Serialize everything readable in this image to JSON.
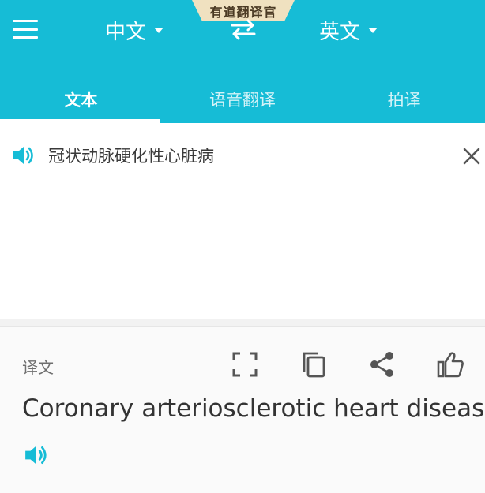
{
  "brand": "有道翻译官",
  "header": {
    "source_language": "中文",
    "target_language": "英文"
  },
  "tabs": [
    {
      "label": "文本",
      "active": true
    },
    {
      "label": "语音翻译",
      "active": false
    },
    {
      "label": "拍译",
      "active": false
    }
  ],
  "input": {
    "text": "冠状动脉硬化性心脏病"
  },
  "output": {
    "label": "译文",
    "text": "Coronary arteriosclerotic heart disease",
    "tools": [
      "fullscreen-icon",
      "copy-icon",
      "share-icon",
      "thumbs-up-icon"
    ]
  },
  "colors": {
    "accent": "#16bcd6",
    "badge": "#f0e1c0",
    "icon_gray": "#555555"
  }
}
